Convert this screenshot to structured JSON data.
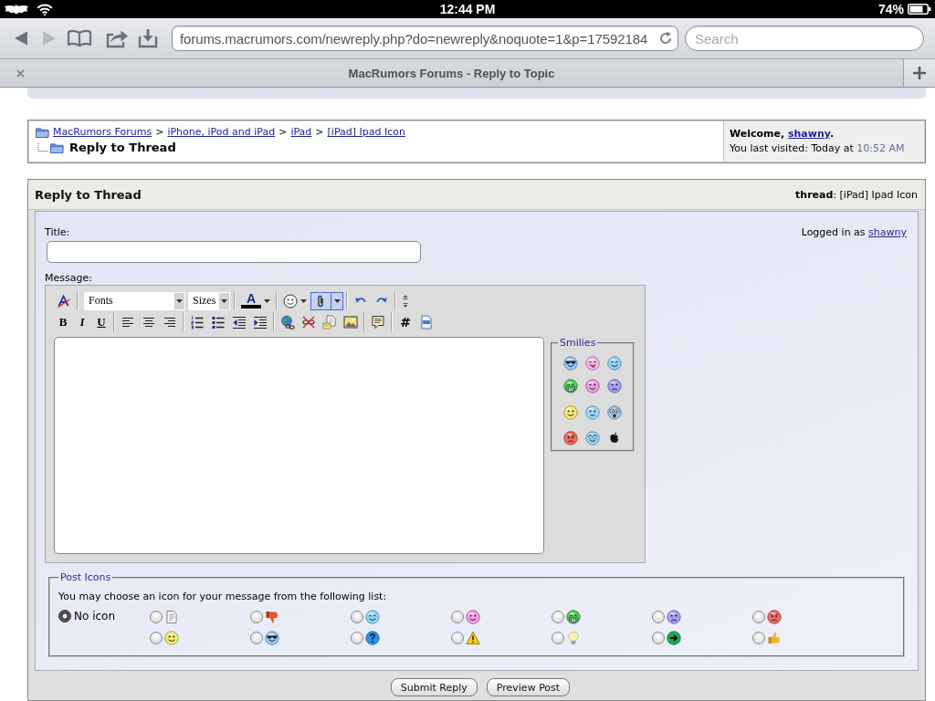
{
  "status_bar": {
    "time": "12:44 PM",
    "battery": "74%"
  },
  "browser": {
    "back": {
      "disabled": false
    },
    "forward": {
      "disabled": true
    },
    "url": "forums.macrumors.com/newreply.php?do=newreply&noquote=1&p=17592184",
    "search": {
      "placeholder": "Search"
    },
    "tab": {
      "title": "MacRumors Forums - Reply to Topic"
    }
  },
  "breadcrumb": {
    "links": [
      {
        "label": "MacRumors Forums",
        "after": ">"
      },
      {
        "label": "iPhone, iPod and iPad",
        "after": ">"
      },
      {
        "label": "iPad",
        "after": ">"
      },
      {
        "label": "[iPad] Ipad Icon"
      }
    ],
    "current": "Reply to Thread"
  },
  "welcome": {
    "greeting": "Welcome,",
    "user": "shawny",
    "end": ".",
    "last_visit": "You last visited: Today at",
    "time": "10:52 AM"
  },
  "panel": {
    "title": "Reply to Thread",
    "thread": "**thread**: [iPad] Ipad Icon"
  },
  "form": {
    "title_label": "Title:",
    "logged_in": {
      "text": "Logged in as",
      "user": "shawny"
    },
    "message_label": "Message:"
  },
  "toolbar": [
    [
      [
        {
          "kind": "removeformat",
          "highlighted": false
        }
      ],
      [
        {
          "kind": "fontselect",
          "label": "Fonts",
          "highlighted": false
        },
        {
          "kind": "sizeselect",
          "label": "Sizes",
          "highlighted": false
        }
      ],
      [
        {
          "kind": "fontcolor",
          "label": "A",
          "highlighted": false
        }
      ],
      [
        {
          "kind": "smilies",
          "highlighted": false
        },
        {
          "kind": "attach",
          "highlighted": true
        }
      ],
      [
        {
          "kind": "undo",
          "highlighted": false
        },
        {
          "kind": "redo",
          "highlighted": false
        }
      ],
      [
        {
          "kind": "resize",
          "highlighted": false
        }
      ]
    ],
    [
      [
        {
          "kind": "bold",
          "label": "B",
          "highlighted": false
        },
        {
          "kind": "italic",
          "label": "I",
          "highlighted": false
        },
        {
          "kind": "underline",
          "label": "U",
          "highlighted": false
        }
      ],
      [
        {
          "kind": "alignleft",
          "highlighted": false
        },
        {
          "kind": "aligncenter",
          "highlighted": false
        },
        {
          "kind": "alignright",
          "highlighted": false
        }
      ],
      [
        {
          "kind": "olist",
          "highlighted": false
        },
        {
          "kind": "ulist",
          "highlighted": false
        },
        {
          "kind": "outdent",
          "highlighted": false
        },
        {
          "kind": "indent",
          "highlighted": false
        }
      ],
      [
        {
          "kind": "link",
          "highlighted": false
        },
        {
          "kind": "unlink",
          "highlighted": false
        },
        {
          "kind": "email",
          "highlighted": false
        },
        {
          "kind": "image",
          "highlighted": false
        }
      ],
      [
        {
          "kind": "quote",
          "highlighted": false
        }
      ],
      [
        {
          "kind": "code",
          "label": "#",
          "highlighted": false
        },
        {
          "kind": "php",
          "highlighted": false
        }
      ]
    ]
  ],
  "smilies": {
    "legend": "Smilies",
    "items": [
      {
        "kind": "cool"
      },
      {
        "kind": "tongue"
      },
      {
        "kind": "wink"
      },
      {
        "kind": "biggrin"
      },
      {
        "kind": "smile"
      },
      {
        "kind": "frown"
      },
      {
        "kind": "happy"
      },
      {
        "kind": "confused"
      },
      {
        "kind": "eek"
      },
      {
        "kind": "mad"
      },
      {
        "kind": "rolleyes"
      },
      {
        "kind": "apple"
      }
    ]
  },
  "post_icons": {
    "legend": "Post Icons",
    "hint": "You may choose an icon for your message from the following list:",
    "options": [
      {
        "kind": "text",
        "label": "No icon",
        "selected": true
      },
      {
        "kind": "document",
        "selected": false
      },
      {
        "kind": "thumbsdown",
        "selected": false
      },
      {
        "kind": "wink",
        "selected": false
      },
      {
        "kind": "smile",
        "selected": false
      },
      {
        "kind": "biggrin",
        "selected": false
      },
      {
        "kind": "frown",
        "selected": false
      },
      {
        "kind": "mad",
        "selected": false
      },
      {
        "kind": "happy",
        "selected": false
      },
      {
        "kind": "cool",
        "selected": false
      },
      {
        "kind": "question",
        "selected": false
      },
      {
        "kind": "warning",
        "selected": false
      },
      {
        "kind": "lightbulb",
        "selected": false
      },
      {
        "kind": "arrow",
        "selected": false
      },
      {
        "kind": "thumbsup",
        "selected": false
      }
    ]
  },
  "buttons": [
    "Submit Reply",
    "Preview Post"
  ]
}
